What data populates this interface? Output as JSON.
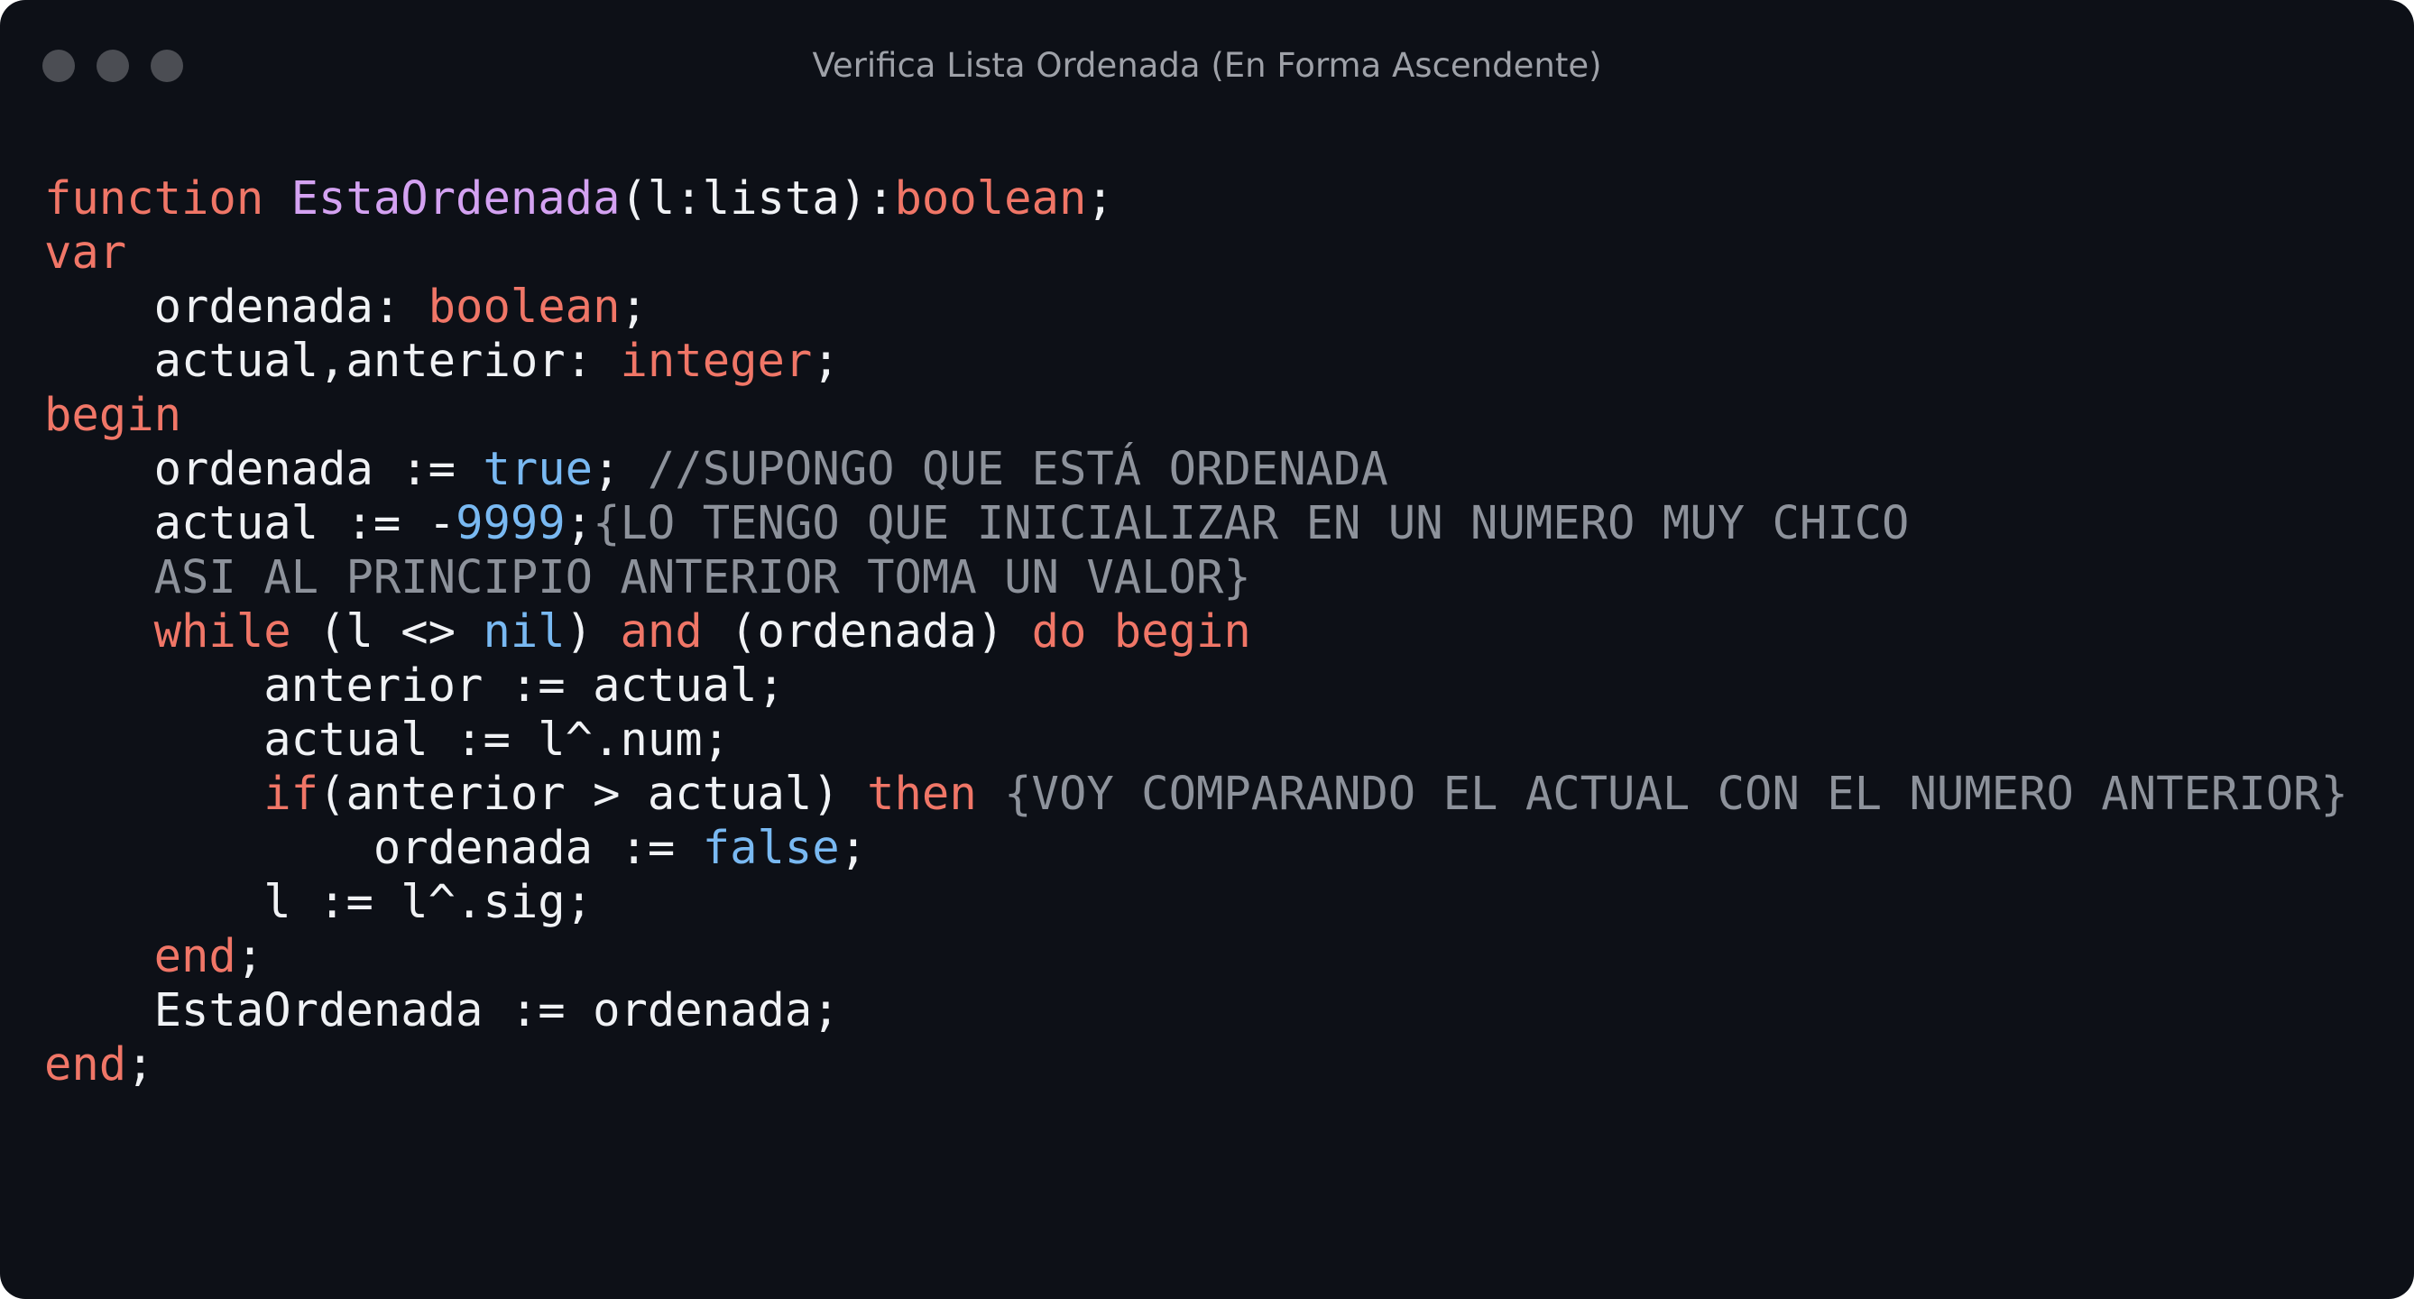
{
  "window": {
    "title": "Verifica Lista Ordenada (En Forma Ascendente)"
  },
  "colors": {
    "background": "#0d1017",
    "keyword": "#f07667",
    "function_name": "#d4a2f2",
    "literal": "#79b9f2",
    "comment": "#8d929b",
    "text": "#f0f2f5"
  },
  "code": {
    "lines": [
      [
        {
          "t": "function",
          "c": "kw"
        },
        {
          "t": " "
        },
        {
          "t": "EstaOrdenada",
          "c": "fn"
        },
        {
          "t": "(l:lista):"
        },
        {
          "t": "boolean",
          "c": "kw"
        },
        {
          "t": ";"
        }
      ],
      [
        {
          "t": "var",
          "c": "kw"
        }
      ],
      [
        {
          "t": "    ordenada: "
        },
        {
          "t": "boolean",
          "c": "kw"
        },
        {
          "t": ";"
        }
      ],
      [
        {
          "t": "    actual,anterior: "
        },
        {
          "t": "integer",
          "c": "kw"
        },
        {
          "t": ";"
        }
      ],
      [
        {
          "t": "begin",
          "c": "kw"
        }
      ],
      [
        {
          "t": "    ordenada := "
        },
        {
          "t": "true",
          "c": "lit"
        },
        {
          "t": "; "
        },
        {
          "t": "//SUPONGO QUE ESTÁ ORDENADA",
          "c": "cm"
        }
      ],
      [
        {
          "t": "    actual := -"
        },
        {
          "t": "9999",
          "c": "lit"
        },
        {
          "t": ";"
        },
        {
          "t": "{LO TENGO QUE INICIALIZAR EN UN NUMERO MUY CHICO",
          "c": "cm"
        }
      ],
      [
        {
          "t": "    ASI AL PRINCIPIO ANTERIOR TOMA UN VALOR}",
          "c": "cm"
        }
      ],
      [
        {
          "t": "    "
        },
        {
          "t": "while",
          "c": "kw"
        },
        {
          "t": " (l <> "
        },
        {
          "t": "nil",
          "c": "lit"
        },
        {
          "t": ") "
        },
        {
          "t": "and",
          "c": "kw"
        },
        {
          "t": " (ordenada) "
        },
        {
          "t": "do",
          "c": "kw"
        },
        {
          "t": " "
        },
        {
          "t": "begin",
          "c": "kw"
        }
      ],
      [
        {
          "t": "        anterior := actual;"
        }
      ],
      [
        {
          "t": "        actual := l^.num;"
        }
      ],
      [
        {
          "t": "        "
        },
        {
          "t": "if",
          "c": "kw"
        },
        {
          "t": "(anterior > actual) "
        },
        {
          "t": "then",
          "c": "kw"
        },
        {
          "t": " "
        },
        {
          "t": "{VOY COMPARANDO EL ACTUAL CON EL NUMERO ANTERIOR}",
          "c": "cm"
        }
      ],
      [
        {
          "t": "            ordenada := "
        },
        {
          "t": "false",
          "c": "lit"
        },
        {
          "t": ";"
        }
      ],
      [
        {
          "t": "        l := l^.sig;"
        }
      ],
      [
        {
          "t": "    "
        },
        {
          "t": "end",
          "c": "kw"
        },
        {
          "t": ";"
        }
      ],
      [
        {
          "t": "    EstaOrdenada := ordenada;"
        }
      ],
      [
        {
          "t": "end",
          "c": "kw"
        },
        {
          "t": ";"
        }
      ]
    ]
  }
}
